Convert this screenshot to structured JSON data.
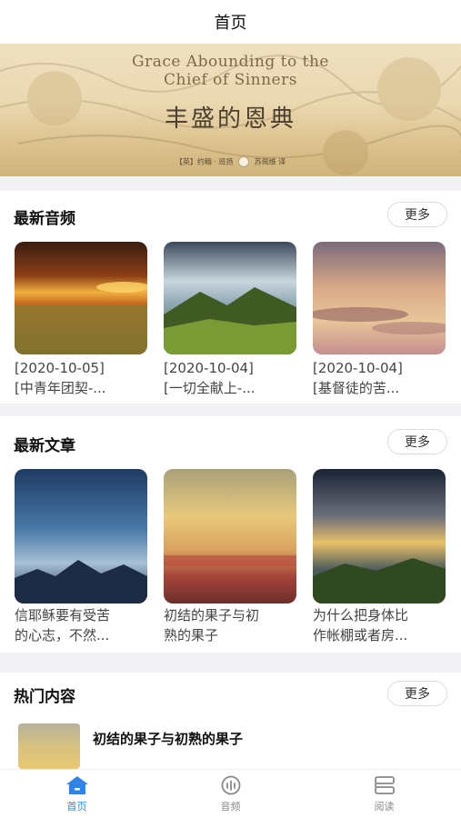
{
  "header": {
    "title": "首页"
  },
  "banner": {
    "title_en_line1": "Grace Abounding to the",
    "title_en_line2": "Chief of Sinners",
    "title_zh": "丰盛的恩典",
    "author": "【英】约翰 · 班扬",
    "translator": "苏佩维 译"
  },
  "audio_section": {
    "title": "最新音频",
    "more_label": "更多",
    "items": [
      {
        "date": "[2020-10-05]",
        "title": "[中青年团契-..."
      },
      {
        "date": "[2020-10-04]",
        "title": "[一切全献上-..."
      },
      {
        "date": "[2020-10-04]",
        "title": "[基督徒的苦..."
      }
    ]
  },
  "article_section": {
    "title": "最新文章",
    "more_label": "更多",
    "items": [
      {
        "line1": "信耶稣要有受苦",
        "line2": "的心志，不然..."
      },
      {
        "line1": "初结的果子与初",
        "line2": "熟的果子"
      },
      {
        "line1": "为什么把身体比",
        "line2": "作帐棚或者房..."
      }
    ]
  },
  "hot_section": {
    "title": "热门内容",
    "more_label": "更多",
    "items": [
      {
        "title": "初结的果子与初熟的果子"
      }
    ]
  },
  "tabbar": {
    "items": [
      {
        "label": "首页",
        "icon": "home-icon",
        "active": true
      },
      {
        "label": "音频",
        "icon": "audio-icon",
        "active": false
      },
      {
        "label": "阅读",
        "icon": "book-icon",
        "active": false
      }
    ]
  },
  "colors": {
    "accent": "#2f84e6",
    "section_gap": "#f2f2f4"
  }
}
